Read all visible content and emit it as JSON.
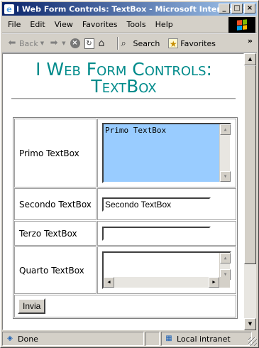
{
  "window": {
    "title": "I Web Form Controls: TextBox - Microsoft Internet Explorer",
    "app_icon": "ie-icon",
    "controls": [
      "minimize",
      "maximize",
      "close"
    ]
  },
  "menu": {
    "items": [
      {
        "label": "File",
        "accel": "F"
      },
      {
        "label": "Edit",
        "accel": "E"
      },
      {
        "label": "View",
        "accel": "V"
      },
      {
        "label": "Favorites",
        "accel": "a"
      },
      {
        "label": "Tools",
        "accel": "T"
      },
      {
        "label": "Help",
        "accel": "H"
      }
    ]
  },
  "toolbar": {
    "back_label": "Back",
    "search_label": "Search",
    "favorites_label": "Favorites",
    "more": "»"
  },
  "page": {
    "heading": "I Web Form Controls: TextBox",
    "heading_color": "#008b8b",
    "rows": [
      {
        "label": "Primo TextBox",
        "type": "textarea",
        "value": "Primo TextBox",
        "background": "#99ccff"
      },
      {
        "label": "Secondo TextBox",
        "type": "text",
        "value": "Secondo TextBox"
      },
      {
        "label": "Terzo TextBox",
        "type": "text",
        "value": ""
      },
      {
        "label": "Quarto TextBox",
        "type": "textarea",
        "value": ""
      }
    ],
    "submit_label": "Invia"
  },
  "status": {
    "text": "Done",
    "zone": "Local intranet"
  }
}
